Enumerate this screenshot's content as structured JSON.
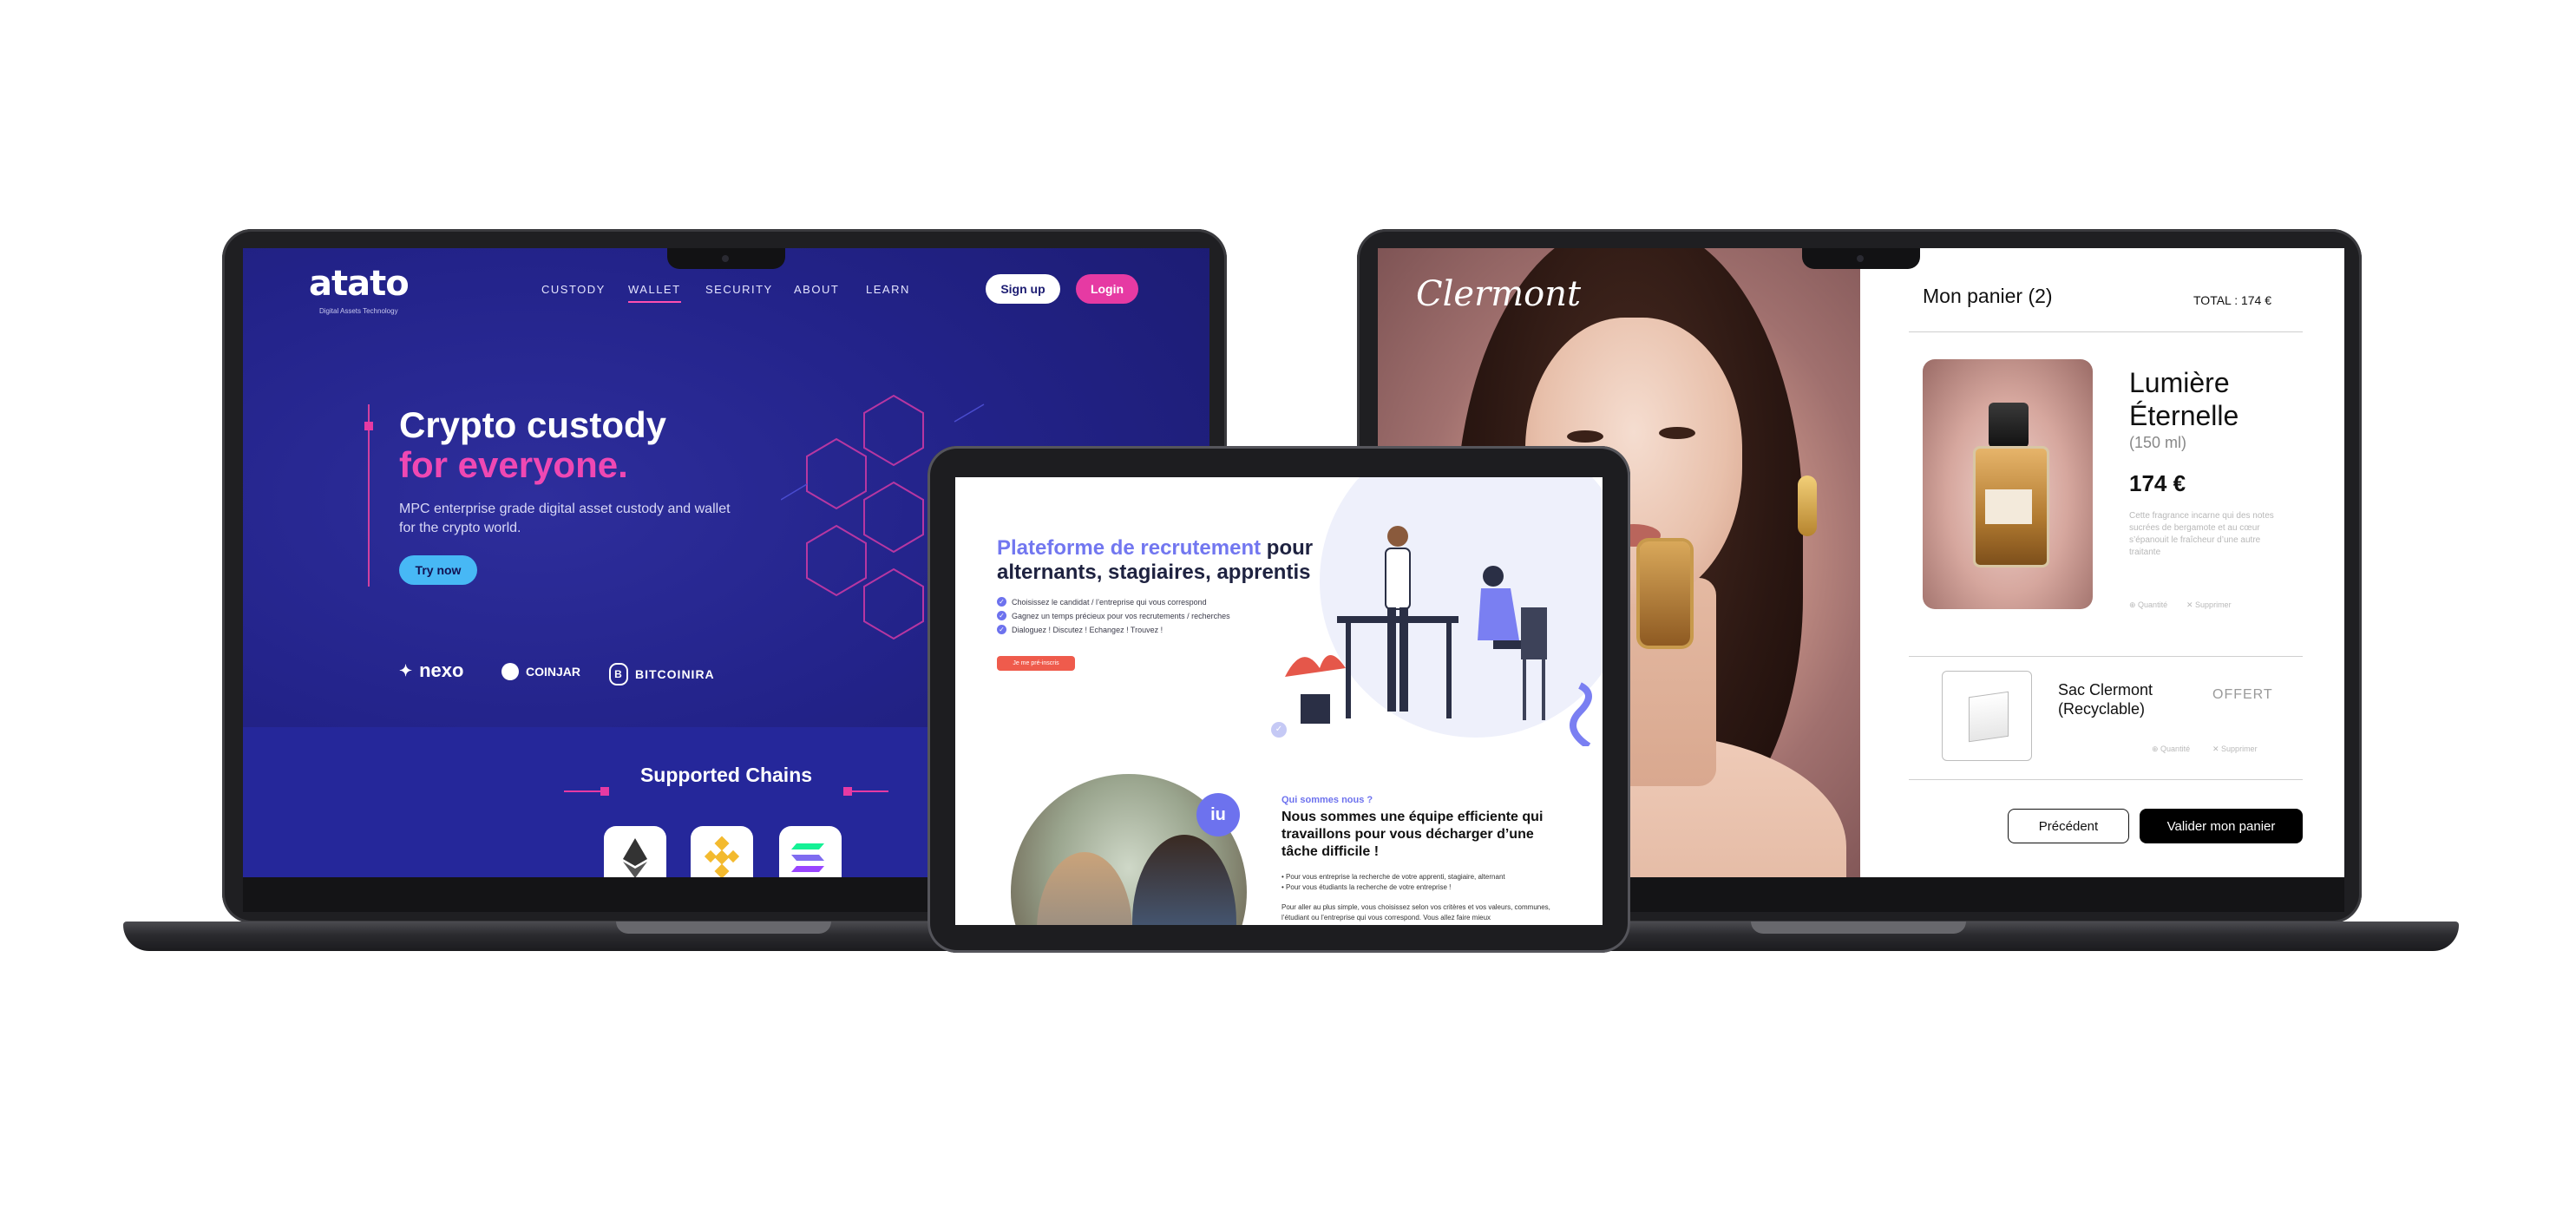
{
  "crypto": {
    "logo": "atato",
    "logo_tagline": "Digital Assets Technology",
    "nav": [
      "CUSTODY",
      "WALLET",
      "SECURITY",
      "ABOUT",
      "LEARN"
    ],
    "nav_active": "WALLET",
    "signup_label": "Sign up",
    "login_label": "Login",
    "hero_line1": "Crypto custody",
    "hero_line2": "for everyone.",
    "hero_desc": "MPC enterprise grade digital asset custody and wallet for the crypto world.",
    "try_label": "Try now",
    "partners": [
      "nexo",
      "COINJAR",
      "BITCOINIRA"
    ],
    "chains_title": "Supported Chains",
    "chains": [
      "ethereum-icon",
      "bnb-icon",
      "solana-icon"
    ],
    "colors": {
      "bg": "#23238a",
      "pink": "#ef48b3",
      "cyan": "#47b8f5"
    }
  },
  "perfume": {
    "brand_signature": "Clermont",
    "cart_title": "Mon panier (2)",
    "total": "TOTAL : 174 €",
    "product": {
      "name_line1": "Lumière",
      "name_line2": "Éternelle",
      "volume": "(150 ml)",
      "price": "174 €",
      "description": "Cette fragrance incarne qui des notes sucrées de bergamote et au cœur s’épanouit le fraîcheur d’une autre traitante",
      "qty_label": "Quantité",
      "remove_label": "Supprimer"
    },
    "bag": {
      "name_line1": "Sac Clermont",
      "name_line2": "(Recyclable)",
      "offer": "OFFERT",
      "qty_label": "Quantité",
      "remove_label": "Supprimer"
    },
    "prev_label": "Précédent",
    "validate_label": "Valider mon panier"
  },
  "recruit": {
    "title_accent": "Plateforme de recrutement",
    "title_rest": " pour alternants, stagiaires, apprentis",
    "checks": [
      "Choisissez le candidat / l’entreprise qui vous correspond",
      "Gagnez un temps précieux pour vos recrutements / recherches",
      "Dialoguez ! Discutez ! Echangez ! Trouvez !"
    ],
    "cta_label": "Je me pré-inscris",
    "badge": "iu",
    "qui_label": "Qui sommes nous ?",
    "qui_title": "Nous sommes une équipe efficiente qui travaillons pour vous décharger d’une tâche difficile !",
    "qui_bullets": [
      "Pour vous entreprise la recherche de votre apprenti, stagiaire, alternant",
      "Pour vous étudiants la recherche de votre entreprise !"
    ],
    "qui_para": "Pour aller au plus simple, vous choisissez selon vos critères et vos valeurs, communes, l’étudiant ou l’entreprise qui vous correspond. Vous allez faire mieux"
  }
}
